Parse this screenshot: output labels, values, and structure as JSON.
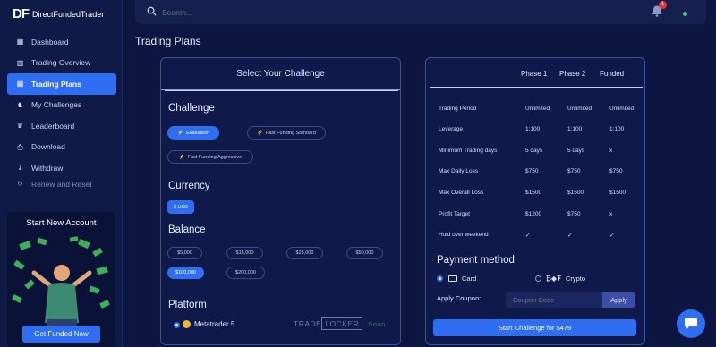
{
  "brand": {
    "mark": "DF",
    "name": "DirectFundedTrader"
  },
  "sidebar": {
    "items": [
      {
        "label": "Dashboard",
        "icon": "dashboard-icon",
        "glyph": "▦"
      },
      {
        "label": "Trading Overview",
        "icon": "chart-icon",
        "glyph": "▥"
      },
      {
        "label": "Trading Plans",
        "icon": "cart-icon",
        "glyph": "▤"
      },
      {
        "label": "My Challenges",
        "icon": "challenges-icon",
        "glyph": "♞"
      },
      {
        "label": "Leaderboard",
        "icon": "trophy-icon",
        "glyph": "♛"
      },
      {
        "label": "Download",
        "icon": "download-icon",
        "glyph": "⎙"
      },
      {
        "label": "Withdraw",
        "icon": "withdraw-icon",
        "glyph": "⤓"
      },
      {
        "label": "Renew and Reset",
        "icon": "renew-icon",
        "glyph": "↻"
      }
    ],
    "promo_title": "Start New Account",
    "promo_button": "Get Funded Now"
  },
  "topbar": {
    "search_placeholder": "Search...",
    "notification_count": "1"
  },
  "page_title": "Trading Plans",
  "challenge_panel": {
    "header": "Select Your Challenge",
    "challenge_label": "Challenge",
    "challenges": [
      "Evaluation",
      "Fast Funding Standard",
      "Fast Funding Aggressive"
    ],
    "selected_challenge": "Evaluation",
    "currency_label": "Currency",
    "currency": "$ USD",
    "balance_label": "Balance",
    "balances": [
      "$5,000",
      "$15,000",
      "$25,000",
      "$50,000",
      "$100,000",
      "$200,000"
    ],
    "selected_balance": "$100,000",
    "platform_label": "Platform",
    "platform_option": "Metatrader 5",
    "tradelocker_a": "TRADE",
    "tradelocker_b": "LOCKER",
    "tradelocker_soon": "Soon"
  },
  "plan_table": {
    "columns": [
      "Phase 1",
      "Phase 2",
      "Funded"
    ],
    "rows": [
      {
        "label": "Trading Period",
        "values": [
          "Unlimited",
          "Unlimited",
          "Unlimited"
        ]
      },
      {
        "label": "Leverage",
        "values": [
          "1:100",
          "1:100",
          "1:100"
        ]
      },
      {
        "label": "Minimum Trading days",
        "values": [
          "5 days",
          "5 days",
          "x"
        ]
      },
      {
        "label": "Max Daily Loss",
        "values": [
          "$750",
          "$750",
          "$750"
        ]
      },
      {
        "label": "Max Overall Loss",
        "values": [
          "$1500",
          "$1500",
          "$1500"
        ]
      },
      {
        "label": "Profit Target",
        "values": [
          "$1200",
          "$750",
          "x"
        ]
      },
      {
        "label": "Hold over weekend",
        "values": [
          "✓",
          "✓",
          "✓"
        ]
      }
    ]
  },
  "payment": {
    "title": "Payment method",
    "card_label": "Card",
    "crypto_label": "Crypto",
    "selected": "Card",
    "coupon_label": "Apply Coupon:",
    "coupon_placeholder": "Coupon Code",
    "apply_label": "Apply",
    "start_button": "Start Challenge for $479"
  },
  "colors": {
    "accent": "#2f6ef2",
    "background": "#0d1640",
    "panel": "#0f1a4a"
  }
}
